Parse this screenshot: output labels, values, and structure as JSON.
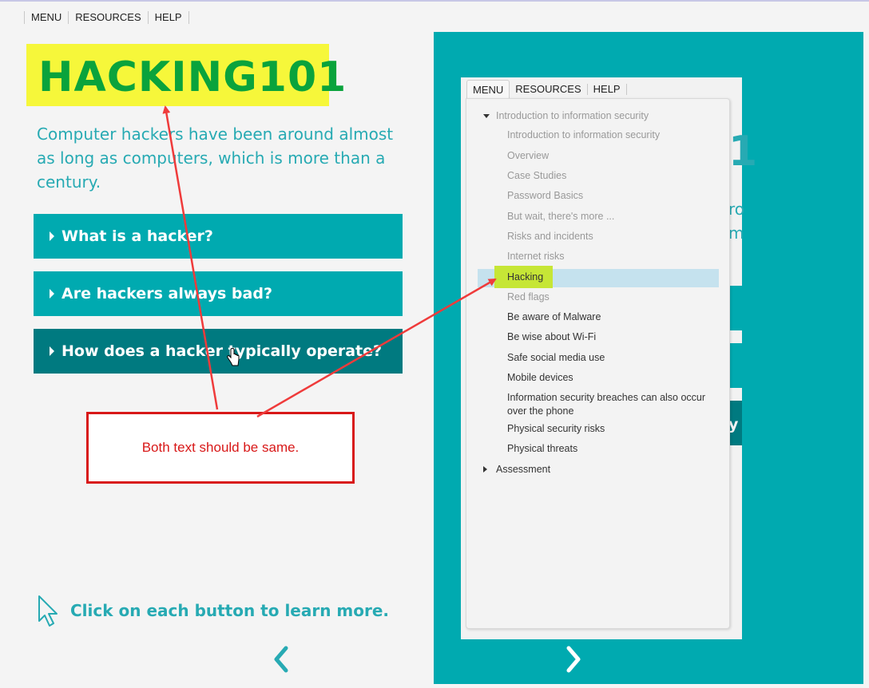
{
  "top_nav": {
    "items": [
      "MENU",
      "RESOURCES",
      "HELP"
    ]
  },
  "page": {
    "title": "HACKING101",
    "intro": "Computer hackers have been around almost as long as computers, which is more than a century.",
    "accordion": [
      {
        "label": "What is a hacker?"
      },
      {
        "label": "Are hackers always bad?"
      },
      {
        "label": "How does a hacker typically operate?"
      }
    ],
    "instruction": "Click on each button to learn more."
  },
  "annotation": {
    "callout_text": "Both text should be same."
  },
  "inner_panel": {
    "tabs": [
      "MENU",
      "RESOURCES",
      "HELP"
    ],
    "menu": {
      "section_1": "Introduction to information security",
      "items": [
        {
          "label": "Introduction to information security",
          "state": "visited"
        },
        {
          "label": "Overview",
          "state": "visited"
        },
        {
          "label": "Case Studies",
          "state": "visited"
        },
        {
          "label": "Password Basics",
          "state": "visited"
        },
        {
          "label": "But wait, there's more ...",
          "state": "visited"
        },
        {
          "label": "Risks and incidents",
          "state": "visited"
        },
        {
          "label": "Internet risks",
          "state": "visited"
        },
        {
          "label": "Hacking",
          "state": "current"
        },
        {
          "label": "Red flags",
          "state": "visited"
        },
        {
          "label": "Be aware of Malware",
          "state": "unvisited"
        },
        {
          "label": "Be wise about Wi-Fi",
          "state": "unvisited"
        },
        {
          "label": "Safe social media use",
          "state": "unvisited"
        },
        {
          "label": "Mobile devices",
          "state": "unvisited"
        },
        {
          "label": "Information security breaches can also occur over the phone",
          "state": "unvisited"
        },
        {
          "label": "Physical security risks",
          "state": "unvisited"
        },
        {
          "label": "Physical threats",
          "state": "unvisited"
        }
      ],
      "section_2": "Assessment"
    },
    "ghost_text": {
      "big": "1",
      "line1": "ro",
      "line2": "m",
      "line3": "y"
    }
  },
  "colors": {
    "teal": "#00aab0",
    "dark_teal": "#007a80",
    "title_green": "#0aa33c",
    "highlight_yellow": "#f6f73a",
    "annotation_red": "#d81818"
  }
}
